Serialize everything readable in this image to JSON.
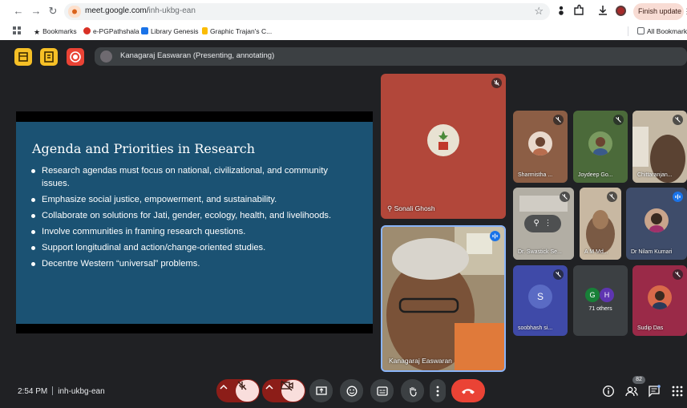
{
  "browser": {
    "url_host": "meet.google.com/",
    "url_path": "inh-ukbg-ean",
    "finish_update_label": "Finish update",
    "bookmarks": [
      {
        "label": "Bookmarks",
        "icon": "star-icon"
      },
      {
        "label": "e-PGPathshala",
        "icon": "site-icon"
      },
      {
        "label": "Library Genesis",
        "icon": "site-icon"
      },
      {
        "label": "Graphic Trajan's C...",
        "icon": "site-icon"
      }
    ],
    "all_bookmarks_label": "All Bookmarks"
  },
  "meet": {
    "presenting_label": "Kanagaraj Easwaran (Presenting, annotating)",
    "slide": {
      "title": "Agenda and Priorities in Research",
      "bullets": [
        "Research agendas must focus on national, civilizational, and community issues.",
        "Emphasize social justice, empowerment, and sustainability.",
        "Collaborate on solutions for Jati, gender, ecology, health, and livelihoods.",
        "Involve communities in framing research questions.",
        "Support longitudinal and action/change-oriented studies.",
        "Decentre Western “universal” problems."
      ]
    },
    "main_participants": {
      "sonali": "Sonali Ghosh",
      "kanagaraj": "Kanagaraj Easwaran"
    },
    "participants": {
      "sharmistha": "Sharmistha ...",
      "joydeep": "Joydeep Go...",
      "chittaranjan": "Chittaranjan...",
      "swastick": "Dr. Swastick Se...",
      "am": "A M Md...",
      "nilam": "Dr Nilam Kumari",
      "soobhash": "soobhash si...",
      "others": "71 others",
      "sudip": "Sudip Das"
    },
    "letters": {
      "s": "S",
      "g": "G",
      "h": "H"
    },
    "time": "2:54 PM",
    "meeting_code": "inh-ukbg-ean",
    "people_count": "82",
    "colors": {
      "end_call": "#ea4335",
      "muted": "#f9dedc",
      "slide_bg": "#1b5273",
      "accent": "#fbbc04"
    }
  }
}
